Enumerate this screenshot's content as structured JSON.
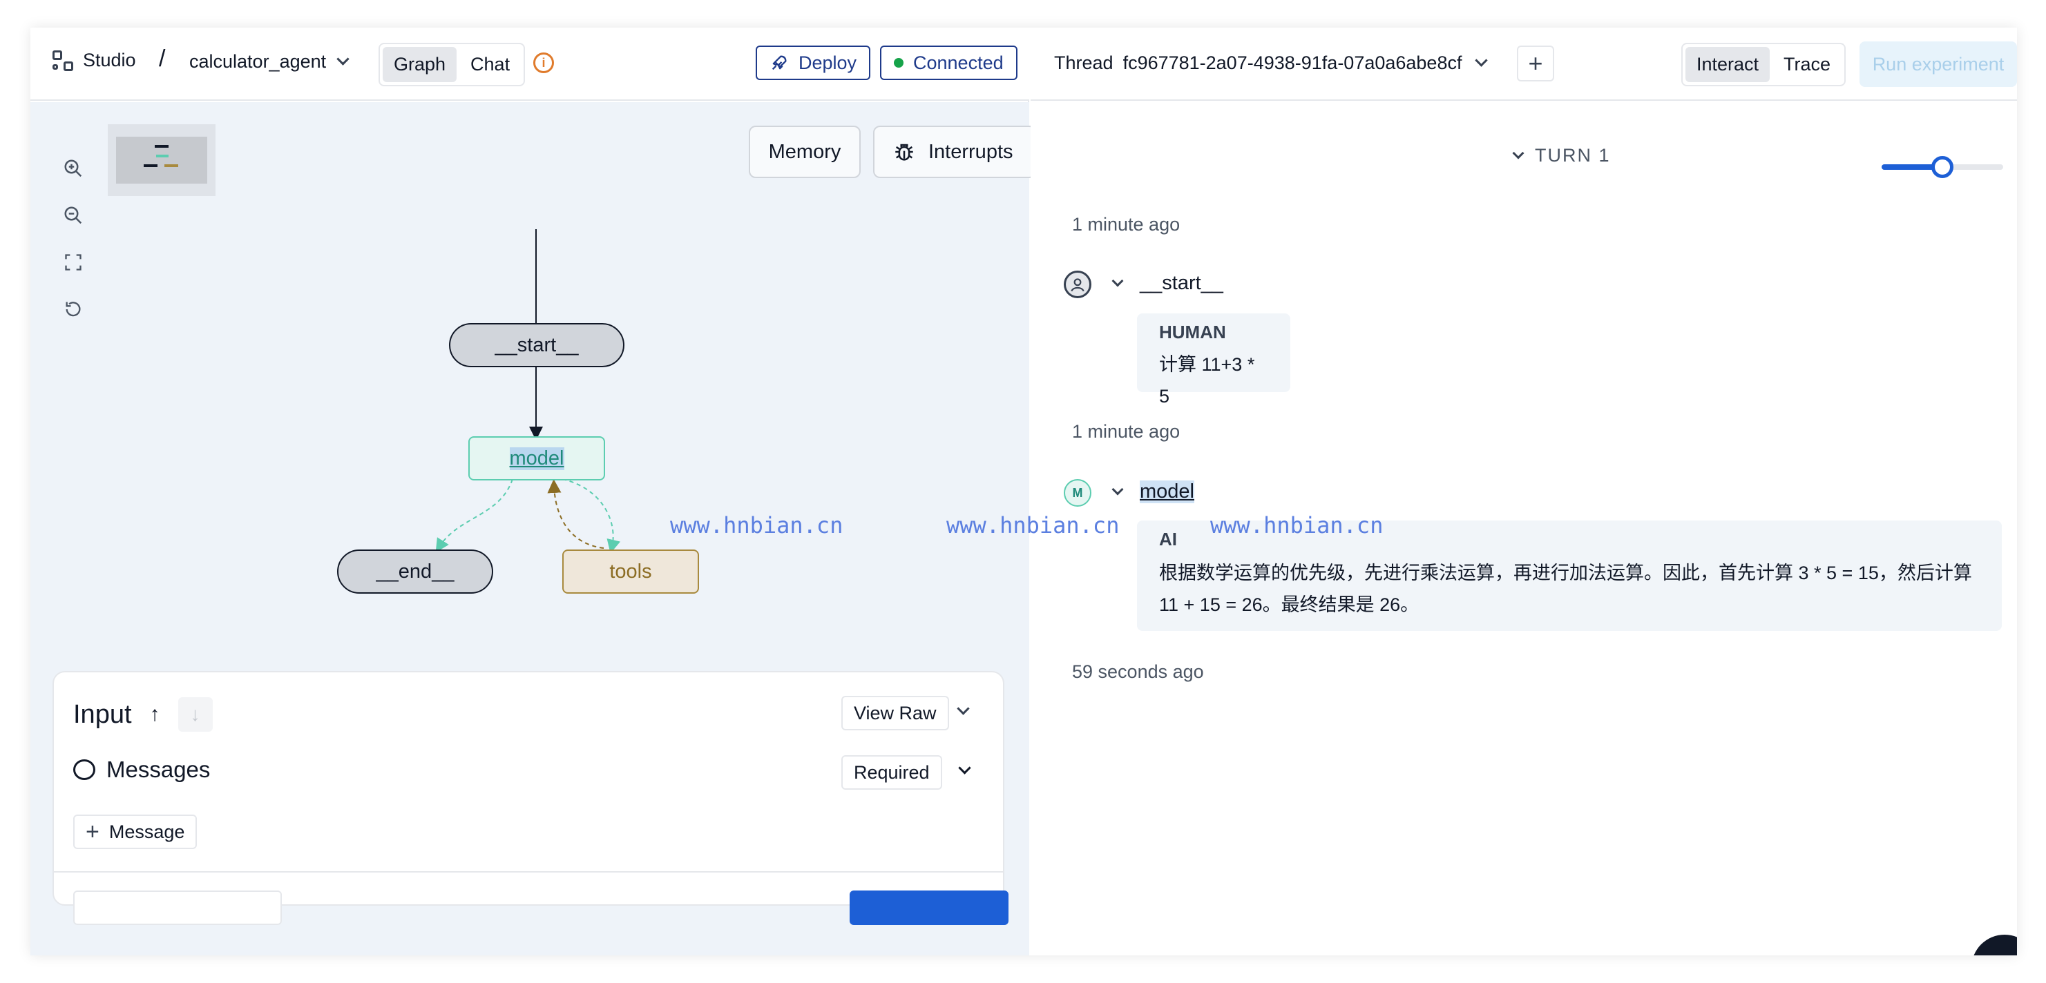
{
  "left": {
    "app_name": "Studio",
    "breadcrumb_sep": "/",
    "project": "calculator_agent",
    "view_tabs": [
      {
        "label": "Graph",
        "active": true
      },
      {
        "label": "Chat",
        "active": false
      }
    ],
    "info_icon": "i",
    "deploy_label": "Deploy",
    "connected_label": "Connected",
    "memory_label": "Memory",
    "interrupts_label": "Interrupts",
    "graph": {
      "nodes": {
        "start": "__start__",
        "model": "model",
        "end": "__end__",
        "tools": "tools"
      }
    },
    "input": {
      "title": "Input",
      "up_arrow": "↑",
      "down_arrow": "↓",
      "view_raw": "View Raw",
      "messages_label": "Messages",
      "required_label": "Required",
      "add_message": "Message",
      "plus": "+"
    }
  },
  "right": {
    "thread_label": "Thread",
    "thread_id": "fc967781-2a07-4938-91fa-07a0a6abe8cf",
    "plus": "+",
    "mode_tabs": [
      {
        "label": "Interact",
        "active": true
      },
      {
        "label": "Trace",
        "active": false
      }
    ],
    "run_experiment": "Run experiment",
    "turn_label": "TURN 1",
    "slider_value": 0.5,
    "entries": [
      {
        "timestamp": "1 minute ago",
        "node": "__start__",
        "role": "HUMAN",
        "text": "计算 11+3 * 5",
        "avatar": "person-icon"
      },
      {
        "timestamp": "1 minute ago",
        "node": "model",
        "role": "AI",
        "text_line1": "根据数学运算的优先级，先进行乘法运算，再进行加法运算。因此，首先计算 3 * 5 = 15，然后计算",
        "text_line2": "11 + 15 = 26。最终结果是 26。",
        "avatar": "M"
      }
    ],
    "last_timestamp": "59 seconds ago"
  },
  "watermarks": [
    "www.hnbian.cn",
    "www.hnbian.cn",
    "www.hnbian.cn"
  ],
  "colors": {
    "accent_blue": "#1d5fd6",
    "connected_green": "#16a34a",
    "model_teal": "#5ccdb0",
    "tools_brown": "#a88a3e"
  }
}
